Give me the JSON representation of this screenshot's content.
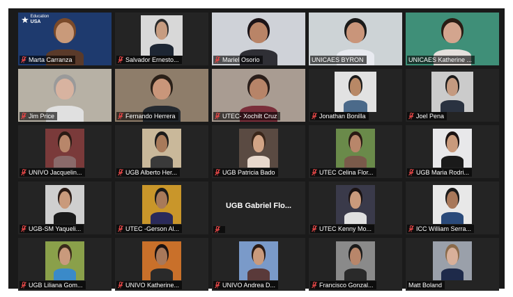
{
  "participants": [
    {
      "name": "Marta Carranza",
      "muted": true,
      "layout": "full",
      "bg": "#1e3a6e",
      "skin": "#c99a7a",
      "shirt": "#5a3a2a",
      "hair": "#7a4a2a"
    },
    {
      "name": "Salvador Ernesto...",
      "muted": true,
      "layout": "mid",
      "bg": "#d8d8d8",
      "skin": "#c79c80",
      "shirt": "#1d2633",
      "hair": "#2a2a2a"
    },
    {
      "name": "Mariel Osorio",
      "muted": true,
      "layout": "full",
      "bg": "#cfd2d8",
      "skin": "#b98467",
      "shirt": "#2f2f35",
      "hair": "#1c1418"
    },
    {
      "name": "UNICAES BYRON",
      "muted": false,
      "layout": "full",
      "bg": "#cdd3d6",
      "skin": "#c9957a",
      "shirt": "#e8eaf0",
      "hair": "#1a1a1a"
    },
    {
      "name": "UNICAES Katherine ...",
      "muted": false,
      "layout": "full",
      "bg": "#3f8f78",
      "skin": "#d3a58e",
      "shirt": "#e5e0dc",
      "hair": "#2a1c14"
    },
    {
      "name": "Jim Price",
      "muted": true,
      "layout": "full",
      "bg": "#b7b1a5",
      "skin": "#d8b3a0",
      "shirt": "#e0e0e0",
      "hair": "#9a9a9a"
    },
    {
      "name": "Fernando Herrera",
      "muted": true,
      "layout": "full",
      "bg": "#8e7d6a",
      "skin": "#c9967a",
      "shirt": "#252a30",
      "hair": "#2a2018"
    },
    {
      "name": "UTEC- Xochilt Cruz",
      "muted": true,
      "layout": "full",
      "bg": "#a99c92",
      "skin": "#b78468",
      "shirt": "#7a2e3a",
      "hair": "#2a1e1a"
    },
    {
      "name": "Jonathan Bonilla",
      "muted": true,
      "layout": "mid",
      "bg": "#e2e2e2",
      "skin": "#b88866",
      "shirt": "#4b6a8a",
      "hair": "#1a1a1a"
    },
    {
      "name": "Joel Pena",
      "muted": true,
      "layout": "mid",
      "bg": "#cbcbcb",
      "skin": "#c49a80",
      "shirt": "#2a3240",
      "hair": "#1a1a1a"
    },
    {
      "name": "UNIVO Jacquelin...",
      "muted": true,
      "layout": "small",
      "bg": "#7a3a3a",
      "skin": "#b8866a",
      "shirt": "#8a6a6a",
      "hair": "#2a1a14"
    },
    {
      "name": "UGB Alberto Her...",
      "muted": true,
      "layout": "small",
      "bg": "#c9b89a",
      "skin": "#a87a5a",
      "shirt": "#3a3a3a",
      "hair": "#1a1a1a"
    },
    {
      "name": "UGB Patricia Bado",
      "muted": true,
      "layout": "small",
      "bg": "#5a4a42",
      "skin": "#d2a486",
      "shirt": "#e8d8cc",
      "hair": "#3a261a"
    },
    {
      "name": "UTEC Celina Flor...",
      "muted": true,
      "layout": "small",
      "bg": "#6a8a4a",
      "skin": "#b8866a",
      "shirt": "#7a5a4a",
      "hair": "#2a1a14"
    },
    {
      "name": "UGB Maria Rodri...",
      "muted": true,
      "layout": "small",
      "bg": "#e8e8ea",
      "skin": "#c99a7c",
      "shirt": "#1a1a1a",
      "hair": "#1a1212"
    },
    {
      "name": "UGB-SM Yaqueli...",
      "muted": true,
      "layout": "small",
      "bg": "#cfcfcf",
      "skin": "#c99a7c",
      "shirt": "#1a1a1a",
      "hair": "#2a1a14"
    },
    {
      "name": "UTEC -Gerson Al...",
      "muted": true,
      "layout": "small",
      "bg": "#c9962a",
      "skin": "#a87a5a",
      "shirt": "#2a2a5a",
      "hair": "#1a1a1a"
    },
    {
      "name": "",
      "muted": true,
      "layout": "none",
      "bg": "#242424",
      "center": "UGB Gabriel Flo..."
    },
    {
      "name": "UTEC Kenny Mo...",
      "muted": true,
      "layout": "small",
      "bg": "#3a3a4a",
      "skin": "#c99a7c",
      "shirt": "#e0e0e0",
      "hair": "#1a1212"
    },
    {
      "name": "ICC William Serra...",
      "muted": true,
      "layout": "small",
      "bg": "#e8e8e8",
      "skin": "#a8785a",
      "shirt": "#2a4a7a",
      "hair": "#1a1a1a"
    },
    {
      "name": "UGB Liliana Gom...",
      "muted": true,
      "layout": "small",
      "bg": "#8aa04a",
      "skin": "#c99a7c",
      "shirt": "#3a8ac9",
      "hair": "#3a2a1a"
    },
    {
      "name": "UNIVO Katherine...",
      "muted": true,
      "layout": "small",
      "bg": "#c9702a",
      "skin": "#a8785a",
      "shirt": "#2a2a2a",
      "hair": "#1a1212"
    },
    {
      "name": "UNIVO Andrea D...",
      "muted": true,
      "layout": "small",
      "bg": "#7a9ac9",
      "skin": "#c99a7c",
      "shirt": "#5a3a3a",
      "hair": "#2a1a14"
    },
    {
      "name": "Francisco Gonzal...",
      "muted": true,
      "layout": "small",
      "bg": "#8a8a8a",
      "skin": "#b8866a",
      "shirt": "#2a2a2a",
      "hair": "#1a1a1a"
    },
    {
      "name": "Matt Boland",
      "muted": false,
      "layout": "small",
      "bg": "#9aa0aa",
      "skin": "#d8b09a",
      "shirt": "#1e2a4a",
      "hair": "#8a6a4a"
    }
  ],
  "active_speaker_index": 4,
  "badge": {
    "line1": "Education",
    "line2": "USA"
  },
  "colors": {
    "mute": "#e04646",
    "active_border": "#e8e26a"
  }
}
